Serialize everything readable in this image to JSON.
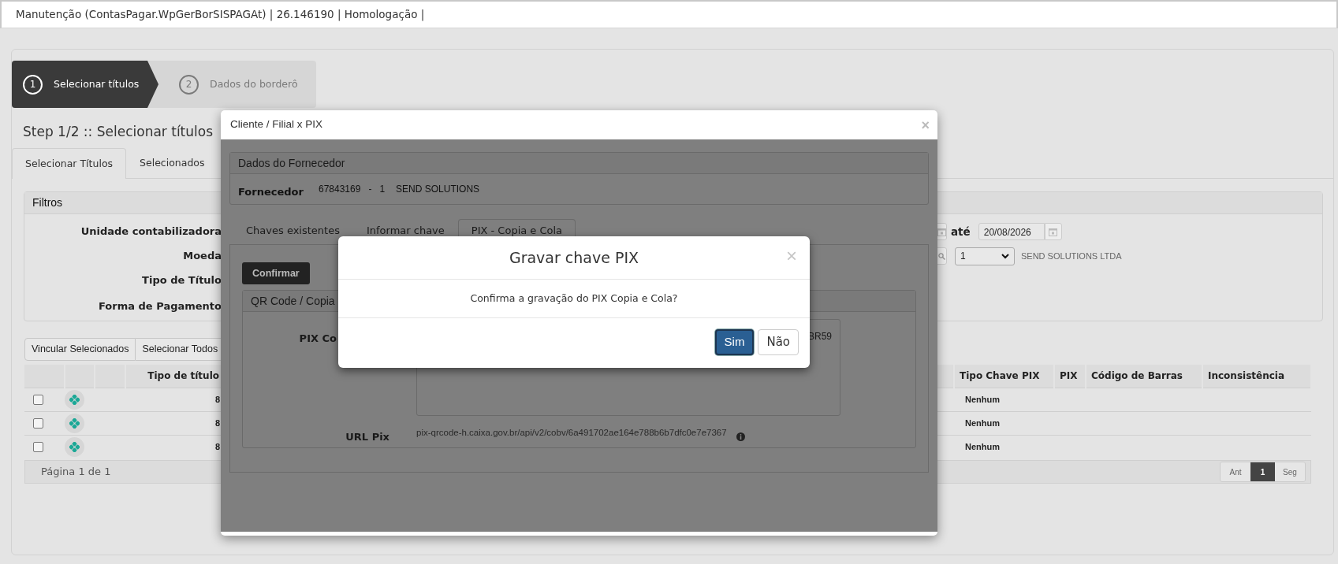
{
  "window": {
    "title": "Manutenção (ContasPagar.WpGerBorSISPAGAt) | 26.146190 | Homologação |"
  },
  "steps": [
    {
      "number": "1",
      "label": "Selecionar títulos",
      "selected": true
    },
    {
      "number": "2",
      "label": "Dados do borderô",
      "selected": false
    }
  ],
  "heading": "Step 1/2 :: Selecionar títulos",
  "tabs": [
    {
      "label": "Selecionar Títulos",
      "selected": true
    },
    {
      "label": "Selecionados",
      "selected": false
    }
  ],
  "filters": {
    "title": "Filtros",
    "labels": [
      "Unidade contabilizadora",
      "Moeda",
      "Tipo de Título",
      "Forma de Pagamento"
    ],
    "date_to_label": "até",
    "date_to": "20/08/2026",
    "select_value": "1",
    "supplier_name": "SEND SOLUTIONS LTDA"
  },
  "actions": [
    "Vincular Selecionados",
    "Selecionar Todos"
  ],
  "table": {
    "columns_left": [
      "Tipo de título"
    ],
    "columns_right": [
      "Tipo Chave PIX",
      "PIX",
      "Código de Barras",
      "Inconsistência"
    ],
    "rows": [
      {
        "checked": false,
        "tipo": "8",
        "tipo_chave_pix": "Nenhum"
      },
      {
        "checked": false,
        "tipo": "8",
        "tipo_chave_pix": "Nenhum"
      },
      {
        "checked": false,
        "tipo": "8",
        "tipo_chave_pix": "Nenhum"
      }
    ]
  },
  "pager": {
    "text": "Página 1 de 1",
    "prev": "Ant",
    "next": "Seg",
    "pages": [
      {
        "label": "1",
        "selected": true
      }
    ]
  },
  "modal": {
    "title": "Cliente / Filial x PIX",
    "close": "×",
    "supplier": {
      "title": "Dados do Fornecedor",
      "label": "Fornecedor",
      "code": "67843169",
      "separator": "-",
      "branch": "1",
      "name": "SEND SOLUTIONS"
    },
    "tabs": [
      {
        "label": "Chaves existentes",
        "selected": false
      },
      {
        "label": "Informar chave",
        "selected": false
      },
      {
        "label": "PIX - Copia e Cola",
        "selected": true
      }
    ],
    "confirm_button": "Confirmar",
    "qr": {
      "title": "QR Code / Copia",
      "pix_label": "PIX Co",
      "pix_value": "BR59",
      "url_label": "URL Pix",
      "url_value": "pix-qrcode-h.caixa.gov.br/api/v2/cobv/6a491702ae164e788b6b7dfc0e7e7367"
    }
  },
  "dialog": {
    "title": "Gravar chave PIX",
    "close": "×",
    "message": "Confirma a gravação do PIX Copia e Cola?",
    "buttons": [
      {
        "label": "Sim",
        "kind": "primary"
      },
      {
        "label": "Não",
        "kind": "secondary"
      }
    ]
  }
}
